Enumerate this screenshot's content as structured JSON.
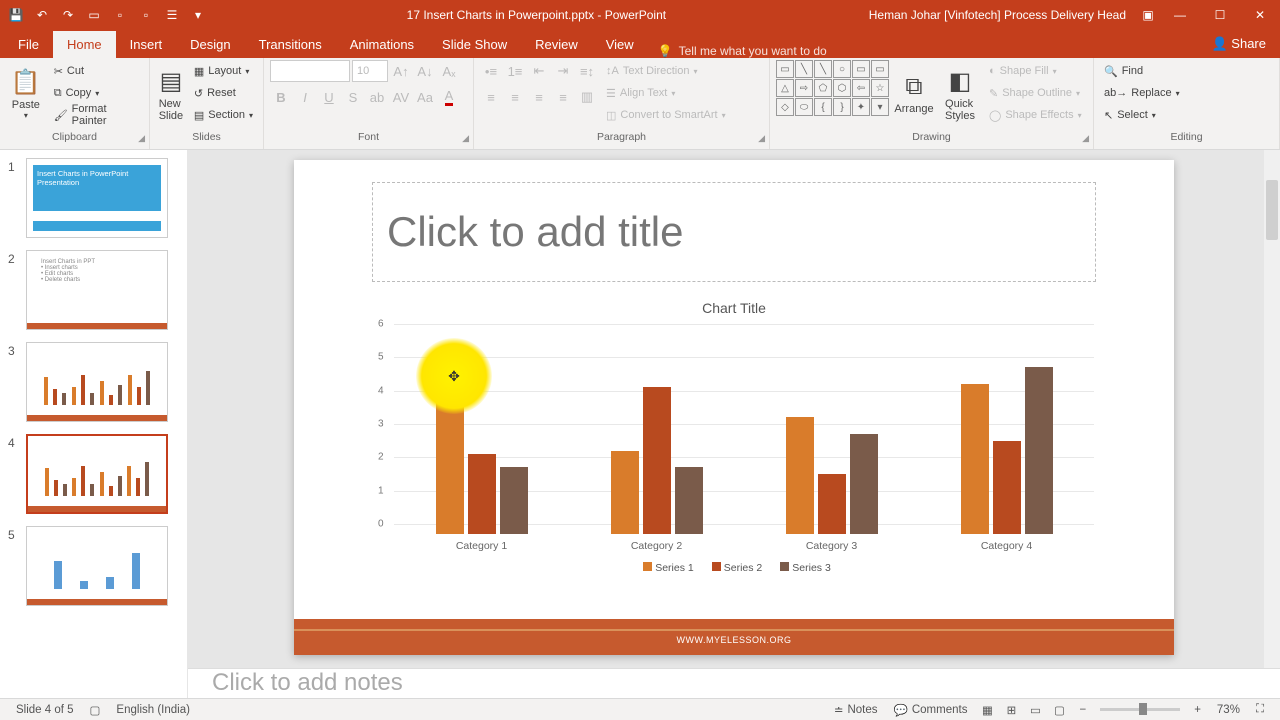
{
  "titlebar": {
    "filename": "17 Insert Charts in Powerpoint.pptx - PowerPoint",
    "user": "Heman Johar [Vinfotech] Process Delivery Head"
  },
  "tabs": {
    "file": "File",
    "home": "Home",
    "insert": "Insert",
    "design": "Design",
    "transitions": "Transitions",
    "animations": "Animations",
    "slideshow": "Slide Show",
    "review": "Review",
    "view": "View",
    "tellme": "Tell me what you want to do",
    "share": "Share"
  },
  "ribbon": {
    "clipboard": {
      "label": "Clipboard",
      "paste": "Paste",
      "cut": "Cut",
      "copy": "Copy",
      "fmt": "Format Painter"
    },
    "slides": {
      "label": "Slides",
      "new": "New\nSlide",
      "layout": "Layout",
      "reset": "Reset",
      "section": "Section"
    },
    "font": {
      "label": "Font",
      "size": "10"
    },
    "paragraph": {
      "label": "Paragraph",
      "textdir": "Text Direction",
      "align": "Align Text",
      "smart": "Convert to SmartArt"
    },
    "drawing": {
      "label": "Drawing",
      "arrange": "Arrange",
      "styles": "Quick\nStyles",
      "fill": "Shape Fill",
      "outline": "Shape Outline",
      "effects": "Shape Effects"
    },
    "editing": {
      "label": "Editing",
      "find": "Find",
      "replace": "Replace",
      "select": "Select"
    }
  },
  "thumbs": {
    "count": 5,
    "active": 4,
    "t1": "Insert Charts in PowerPoint Presentation"
  },
  "slide": {
    "title_placeholder": "Click to add title",
    "footer": "WWW.MYELESSON.ORG",
    "notes_placeholder": "Click to add notes"
  },
  "chart_data": {
    "type": "bar",
    "title": "Chart Title",
    "categories": [
      "Category 1",
      "Category 2",
      "Category 3",
      "Category 4"
    ],
    "series": [
      {
        "name": "Series 1",
        "values": [
          4.3,
          2.5,
          3.5,
          4.5
        ],
        "color": "#d97c2b"
      },
      {
        "name": "Series 2",
        "values": [
          2.4,
          4.4,
          1.8,
          2.8
        ],
        "color": "#b84a1f"
      },
      {
        "name": "Series 3",
        "values": [
          2.0,
          2.0,
          3.0,
          5.0
        ],
        "color": "#7a5b4a"
      }
    ],
    "ylim": [
      0,
      6
    ],
    "yticks": [
      0,
      1,
      2,
      3,
      4,
      5,
      6
    ]
  },
  "statusbar": {
    "slide": "Slide 4 of 5",
    "lang": "English (India)",
    "notes": "Notes",
    "comments": "Comments",
    "zoom": "73%"
  }
}
